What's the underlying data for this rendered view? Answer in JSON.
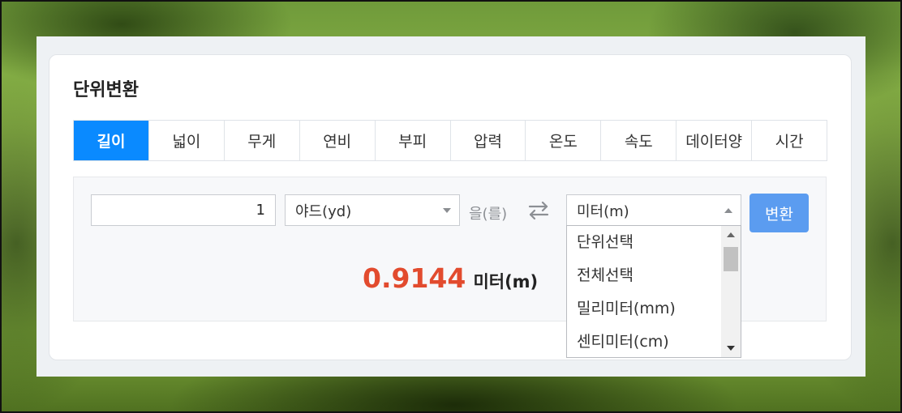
{
  "title": "단위변환",
  "tabs": [
    "길이",
    "넓이",
    "무게",
    "연비",
    "부피",
    "압력",
    "온도",
    "속도",
    "데이터양",
    "시간"
  ],
  "active_tab": 0,
  "converter": {
    "input_value": "1",
    "from_unit": "야드(yd)",
    "particle": "을(를)",
    "swap_icon": "swap-arrows-icon",
    "to_unit": "미터(m)",
    "convert_label": "변환"
  },
  "result": {
    "value": "0.9144",
    "unit": "미터(m)"
  },
  "dropdown": {
    "options": [
      "단위선택",
      "전체선택",
      "밀리미터(mm)",
      "센티미터(cm)"
    ]
  },
  "colors": {
    "tab_active": "#0a8aff",
    "button": "#5b9cf0",
    "result_value": "#e24b2e"
  }
}
